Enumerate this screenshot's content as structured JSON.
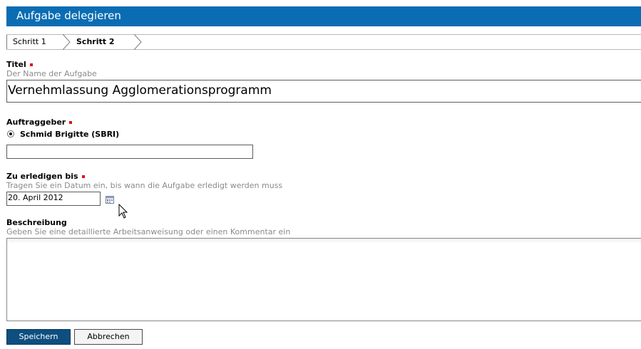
{
  "header": {
    "title": "Aufgabe delegieren"
  },
  "steps": [
    {
      "label": "Schritt 1"
    },
    {
      "label": "Schritt 2"
    }
  ],
  "fields": {
    "title": {
      "label": "Titel",
      "hint": "Der Name der Aufgabe",
      "value": "Vernehmlassung Agglomerationsprogramm"
    },
    "client": {
      "label": "Auftraggeber",
      "selected_person": "Schmid Brigitte (SBRI)",
      "value": ""
    },
    "due": {
      "label": "Zu erledigen bis",
      "hint": "Tragen Sie ein Datum ein, bis wann die Aufgabe erledigt werden muss",
      "value": "20. April 2012"
    },
    "description": {
      "label": "Beschreibung",
      "hint": "Geben Sie eine detaillierte Arbeitsanweisung oder einen Kommentar ein",
      "value": ""
    }
  },
  "buttons": {
    "save": "Speichern",
    "cancel": "Abbrechen"
  },
  "colors": {
    "header": "#0a6db3",
    "required": "#e01010",
    "save_button": "#0e4f80"
  }
}
